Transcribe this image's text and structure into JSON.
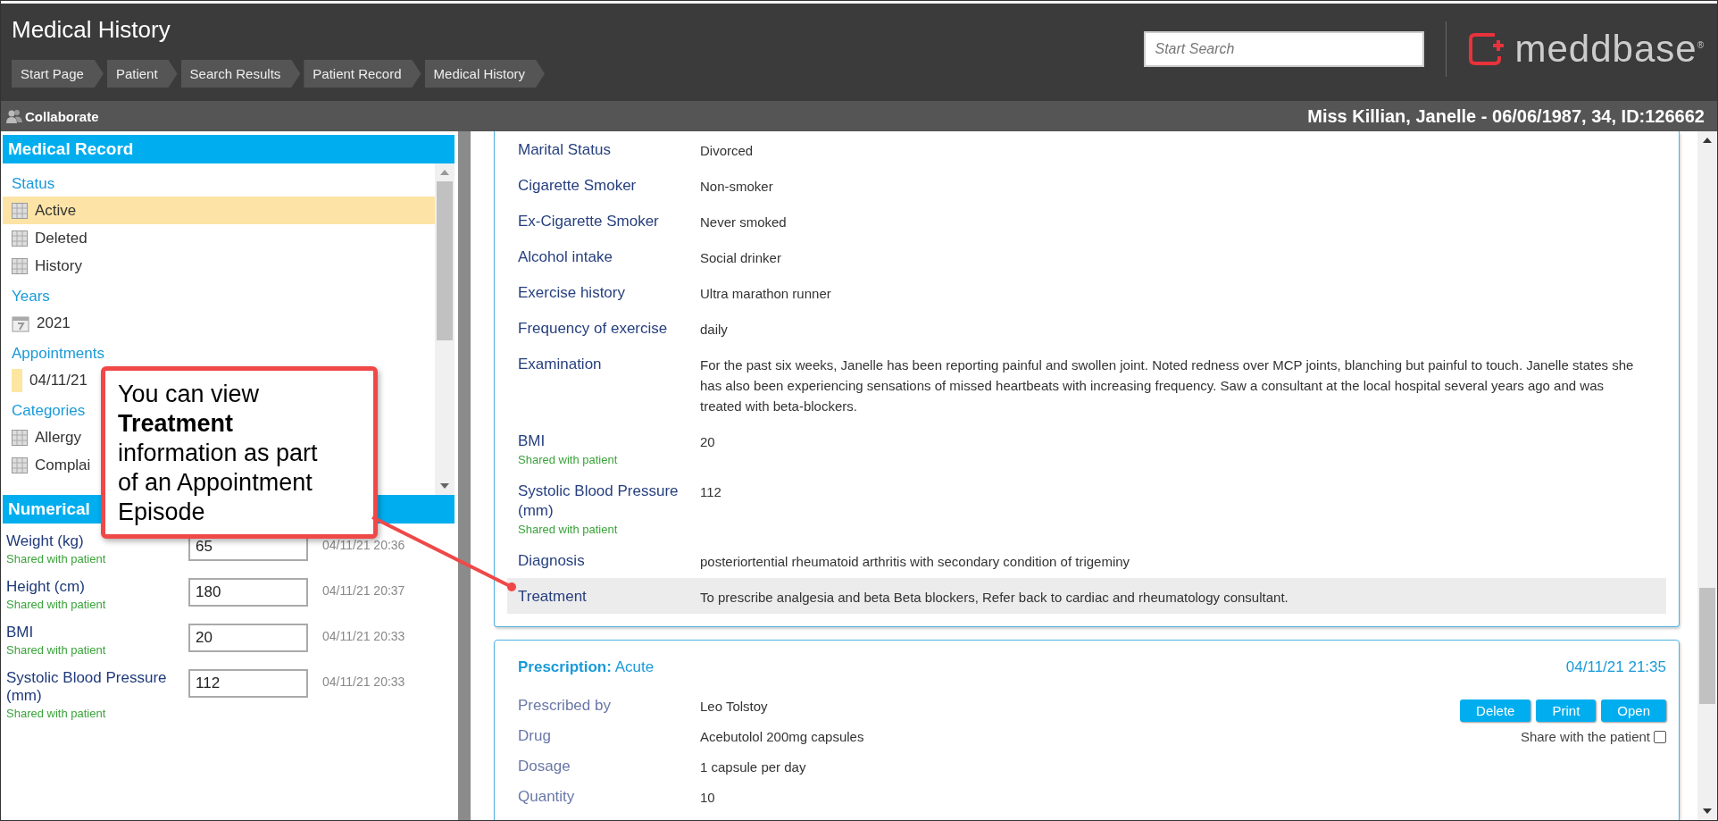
{
  "header": {
    "title": "Medical History",
    "breadcrumbs": [
      "Start Page",
      "Patient",
      "Search Results",
      "Patient Record",
      "Medical History"
    ],
    "search": {
      "placeholder": "Start Search"
    },
    "logo": "meddbase$^{®}$"
  },
  "toolbar": {
    "collaborate": "Collaborate",
    "patient": "Miss Killian, Janelle - 06/06/1987, 34, ID:126662"
  },
  "medical_record": {
    "title": "Medical Record",
    "groups": [
      {
        "heading": "Status",
        "items": [
          {
            "label": "Active",
            "kind": "grid",
            "selected": true
          },
          {
            "label": "Deleted",
            "kind": "grid",
            "selected": false
          },
          {
            "label": "History",
            "kind": "grid",
            "selected": false
          }
        ]
      },
      {
        "heading": "Years",
        "items": [
          {
            "label": "2021",
            "kind": "calendar",
            "selected": false
          }
        ]
      },
      {
        "heading": "Appointments",
        "items": [
          {
            "label": "04/11/21",
            "kind": "swatch",
            "selected": false
          }
        ]
      },
      {
        "heading": "Categories",
        "items": [
          {
            "label": "Allergy",
            "kind": "grid",
            "selected": false
          },
          {
            "label": "Complai",
            "kind": "grid",
            "selected": false
          }
        ]
      }
    ]
  },
  "numerical_data": {
    "title": "Numerical",
    "rows": [
      {
        "label": "Weight (kg)",
        "note": "Shared with patient",
        "value": "65",
        "time": "04/11/21 20:36"
      },
      {
        "label": "Height (cm)",
        "note": "Shared with patient",
        "value": "180",
        "time": "04/11/21 20:37"
      },
      {
        "label": "BMI",
        "note": "Shared with patient",
        "value": "20",
        "time": "04/11/21 20:33"
      },
      {
        "label": "Systolic Blood Pressure (mm)",
        "note": "Shared with patient",
        "value": "112",
        "time": "04/11/21 20:33"
      }
    ]
  },
  "episode": {
    "rows": [
      {
        "label": "Marital Status",
        "value": "Divorced",
        "selected": false
      },
      {
        "label": "Cigarette Smoker",
        "value": "Non-smoker",
        "selected": false
      },
      {
        "label": "Ex-Cigarette Smoker",
        "value": "Never smoked",
        "selected": false
      },
      {
        "label": "Alcohol intake",
        "value": "Social drinker",
        "selected": false
      },
      {
        "label": "Exercise history",
        "value": "Ultra marathon runner",
        "selected": false
      },
      {
        "label": "Frequency of exercise",
        "value": "daily",
        "selected": false
      },
      {
        "label": "Examination",
        "value": "For the past six weeks, Janelle has been reporting painful and swollen joint. Noted redness over MCP joints, blanching but painful to touch. Janelle states she has also been experiencing sensations of missed heartbeats with increasing frequency. Saw a consultant at the local hospital several years ago and was treated with beta-blockers.",
        "selected": false
      },
      {
        "label": "BMI",
        "note": "Shared with patient",
        "value": "20",
        "selected": false
      },
      {
        "label": "Systolic Blood Pressure (mm)",
        "note": "Shared with patient",
        "value": "112",
        "selected": false
      },
      {
        "label": "Diagnosis",
        "value": "posteriortential rheumatoid arthritis with secondary condition of trigeminy",
        "selected": false
      },
      {
        "label": "Treatment",
        "value": "To prescribe analgesia and beta Beta blockers, Refer back to cardiac and rheumatology consultant.",
        "selected": true
      }
    ]
  },
  "prescription": {
    "title": "Prescription:",
    "type": "Acute",
    "time": "04/11/21 21:35",
    "rows": [
      {
        "label": "Prescribed by",
        "value": "Leo Tolstoy"
      },
      {
        "label": "Drug",
        "value": "Acebutolol 200mg capsules"
      },
      {
        "label": "Dosage",
        "value": "1 capsule per day"
      },
      {
        "label": "Quantity",
        "value": "10"
      }
    ],
    "buttons": [
      "Delete",
      "Print",
      "Open"
    ],
    "share": {
      "label": "Share with the patient",
      "checked": false
    }
  },
  "callout": {
    "text": "You can view **Treatment** information as part of an Appointment Episode"
  }
}
